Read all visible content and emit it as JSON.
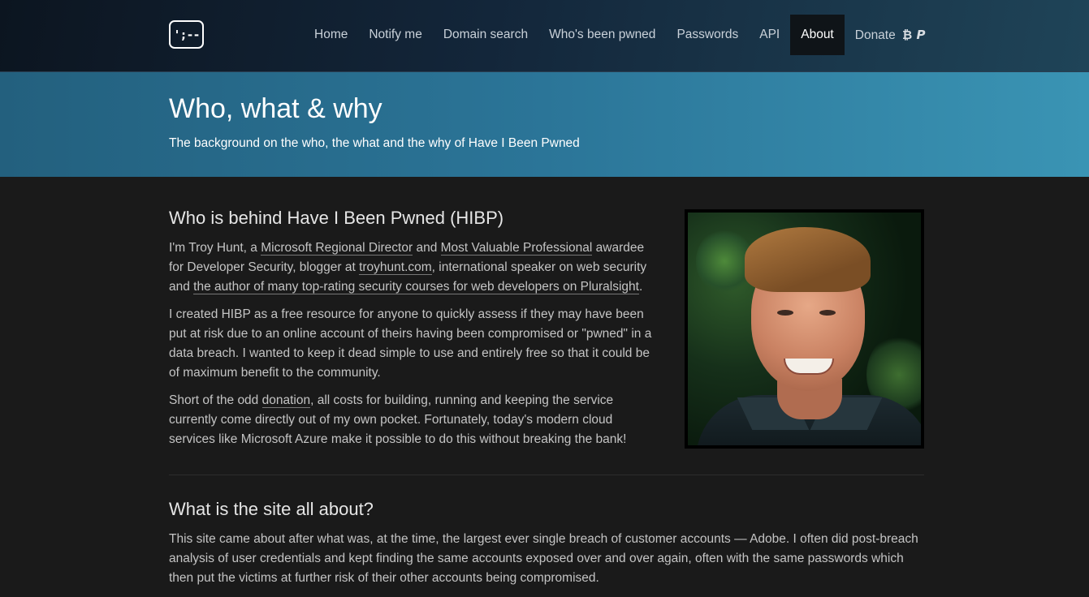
{
  "nav": {
    "logo": "';--",
    "items": [
      {
        "label": "Home",
        "active": false
      },
      {
        "label": "Notify me",
        "active": false
      },
      {
        "label": "Domain search",
        "active": false
      },
      {
        "label": "Who's been pwned",
        "active": false
      },
      {
        "label": "Passwords",
        "active": false
      },
      {
        "label": "API",
        "active": false
      },
      {
        "label": "About",
        "active": true
      }
    ],
    "donate": {
      "label": "Donate",
      "icons": [
        "bitcoin-icon",
        "paypal-icon"
      ],
      "bitcoin_glyph": "₿",
      "paypal_glyph": "P"
    }
  },
  "hero": {
    "title": "Who, what & why",
    "subtitle": "The background on the who, the what and the why of Have I Been Pwned"
  },
  "section1": {
    "heading": "Who is behind Have I Been Pwned (HIBP)",
    "p1": {
      "t1": "I'm Troy Hunt, a ",
      "link1": "Microsoft Regional Director",
      "t2": " and ",
      "link2": "Most Valuable Professional",
      "t3": " awardee for Developer Security, blogger at ",
      "link3": "troyhunt.com",
      "t4": ", international speaker on web security and ",
      "link4": "the author of many top-rating security courses for web developers on Pluralsight",
      "t5": "."
    },
    "p2": "I created HIBP as a free resource for anyone to quickly assess if they may have been put at risk due to an online account of theirs having been compromised or \"pwned\" in a data breach. I wanted to keep it dead simple to use and entirely free so that it could be of maximum benefit to the community.",
    "p3": {
      "t1": "Short of the odd ",
      "link1": "donation",
      "t2": ", all costs for building, running and keeping the service currently come directly out of my own pocket. Fortunately, today's modern cloud services like Microsoft Azure make it possible to do this without breaking the bank!"
    }
  },
  "section2": {
    "heading": "What is the site all about?",
    "p1": "This site came about after what was, at the time, the largest ever single breach of customer accounts — Adobe. I often did post-breach analysis of user credentials and kept finding the same accounts exposed over and over again, often with the same passwords which then put the victims at further risk of their other accounts being compromised."
  }
}
